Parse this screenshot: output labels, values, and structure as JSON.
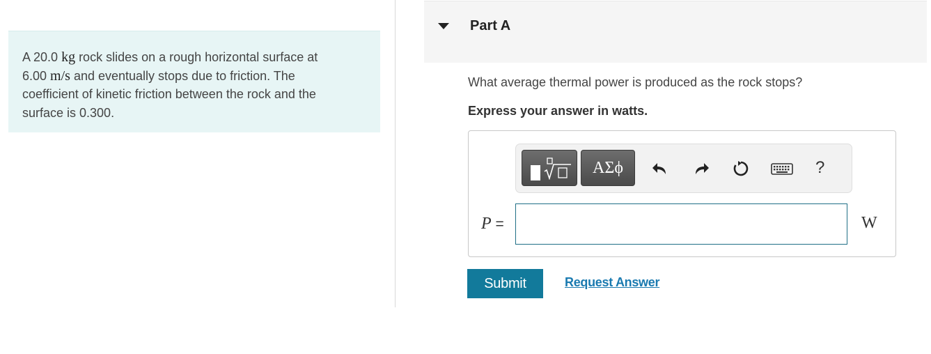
{
  "problem": {
    "text_1": "A 20.0 ",
    "unit_mass": "kg",
    "text_2": " rock slides on a rough horizontal surface at",
    "text_3": "6.00 ",
    "unit_speed": "m/s",
    "text_4": " and eventually stops due to friction. The",
    "text_5": "coefficient of kinetic friction between the rock and the",
    "text_6": "surface is 0.300."
  },
  "part": {
    "title": "Part A",
    "question": "What average thermal power is produced as the rock stops?",
    "instruction": "Express your answer in watts."
  },
  "toolbar": {
    "symbols_label": "ΑΣϕ",
    "help_label": "?",
    "icons": [
      "templates-icon",
      "undo-icon",
      "redo-icon",
      "reset-icon",
      "keyboard-icon",
      "help-icon"
    ]
  },
  "answer": {
    "variable": "P",
    "equals": " =",
    "value": "",
    "unit": "W"
  },
  "buttons": {
    "submit": "Submit",
    "request_answer": "Request Answer"
  },
  "colors": {
    "problem_bg": "#e7f5f5",
    "accent": "#127a9b",
    "link": "#1a7ab0"
  }
}
